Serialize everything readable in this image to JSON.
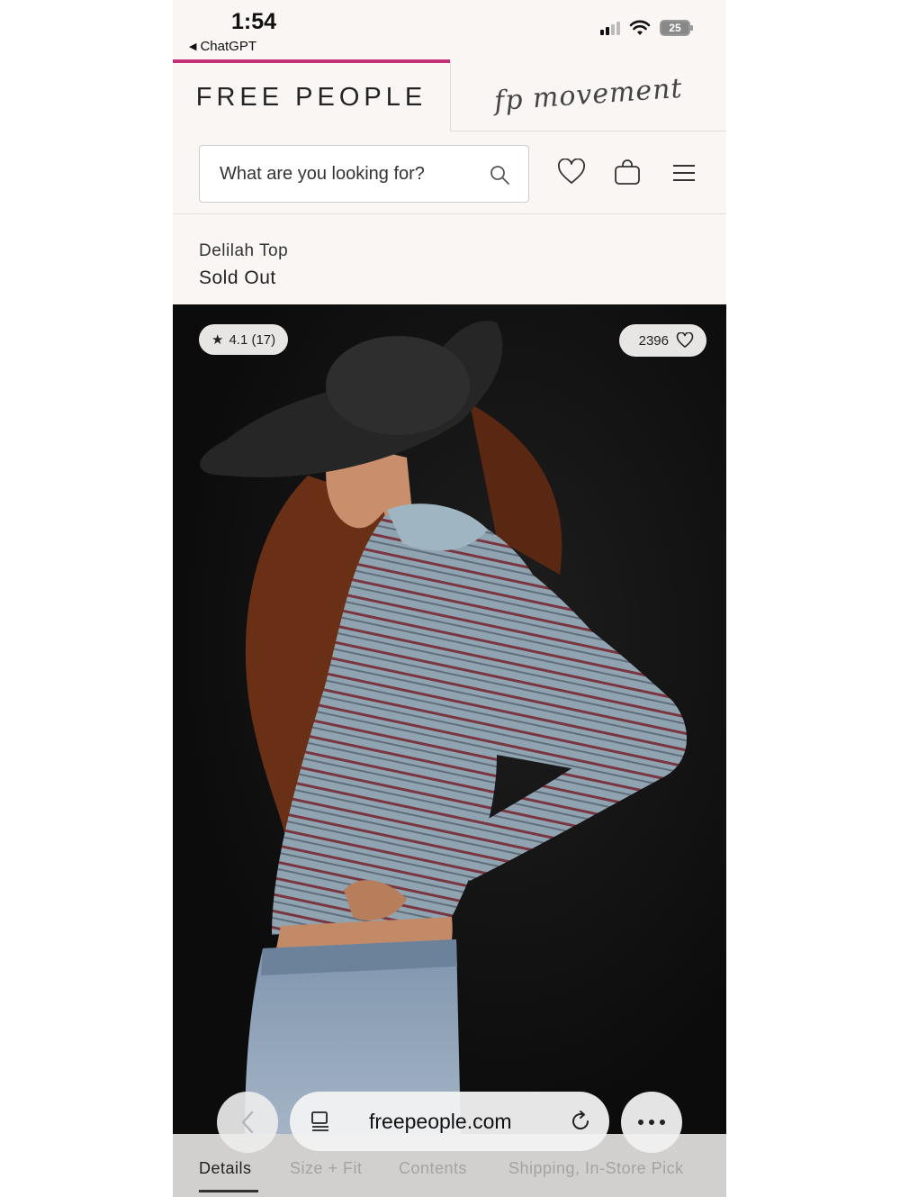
{
  "status_bar": {
    "time": "1:54",
    "back_app": "ChatGPT",
    "battery": "25"
  },
  "brand_tabs": [
    {
      "label": "FREE PEOPLE",
      "active": true
    },
    {
      "label": "fp movement",
      "active": false
    }
  ],
  "search": {
    "placeholder": "What are you looking for?"
  },
  "header_icons": [
    "search-icon",
    "heart-icon",
    "bag-icon",
    "menu-icon"
  ],
  "product": {
    "name": "Delilah Top",
    "status": "Sold Out",
    "rating": "4.1 (17)",
    "likes": "2396"
  },
  "browser": {
    "url": "freepeople.com"
  },
  "detail_tabs": [
    {
      "label": "Details",
      "active": true
    },
    {
      "label": "Size + Fit",
      "active": false
    },
    {
      "label": "Contents",
      "active": false
    },
    {
      "label": "Shipping, In-Store Pick",
      "active": false
    }
  ],
  "colors": {
    "accent": "#c2307a",
    "background": "#faf6f4"
  }
}
